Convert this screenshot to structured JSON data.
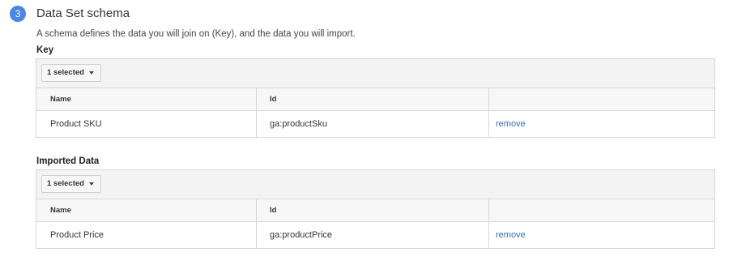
{
  "section": {
    "step_number": "3",
    "title": "Data Set schema",
    "description": "A schema defines the data you will join on (Key), and the data you will import."
  },
  "key": {
    "label": "Key",
    "dropdown_label": "1 selected",
    "columns": [
      "Name",
      "Id",
      ""
    ],
    "rows": [
      {
        "name": "Product SKU",
        "id": "ga:productSku",
        "action": "remove"
      }
    ]
  },
  "imported": {
    "label": "Imported Data",
    "dropdown_label": "1 selected",
    "columns": [
      "Name",
      "Id",
      ""
    ],
    "rows": [
      {
        "name": "Product Price",
        "id": "ga:productPrice",
        "action": "remove"
      }
    ]
  },
  "colors": {
    "step_badge": "#4a86e8",
    "link": "#3a6fb0",
    "toolbar_bg": "#f3f3f3",
    "border": "#d6d6d6"
  }
}
